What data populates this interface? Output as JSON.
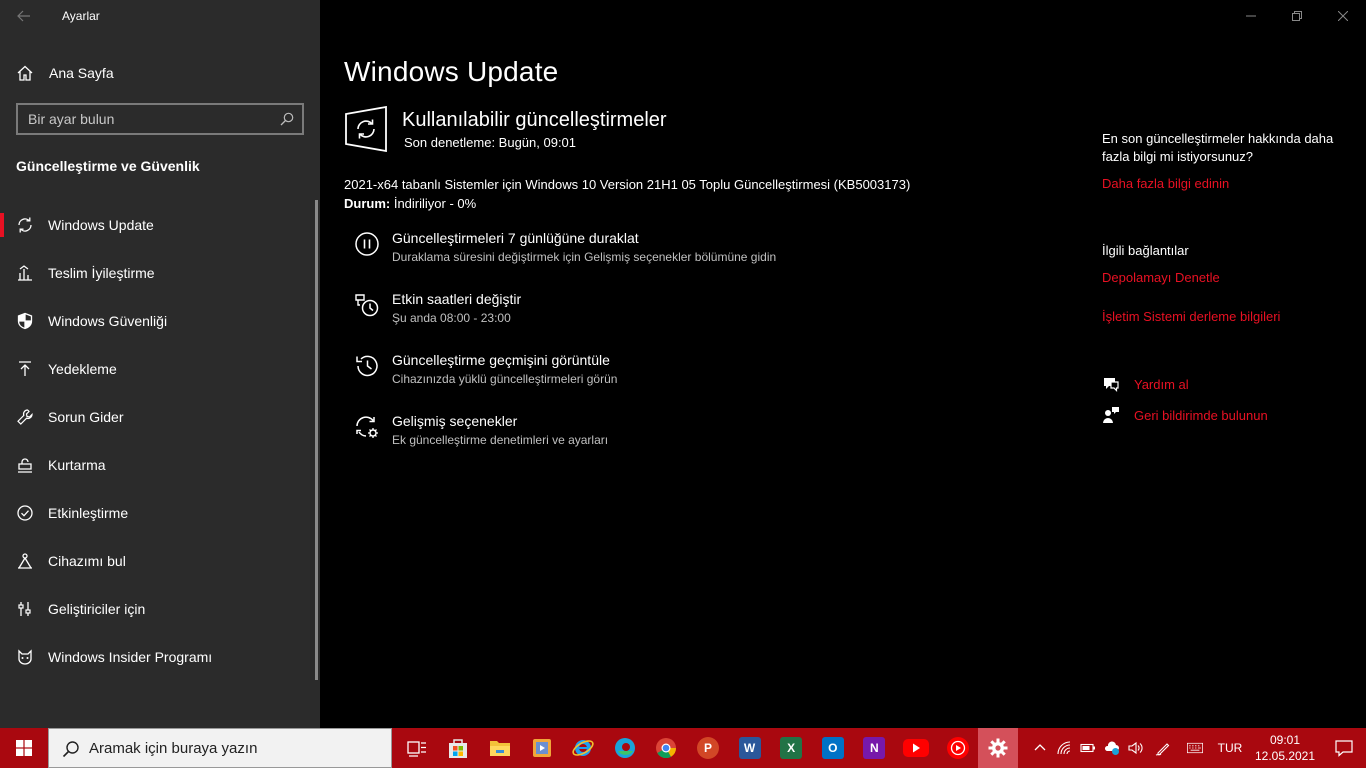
{
  "window": {
    "title": "Ayarlar"
  },
  "sidebar": {
    "home_label": "Ana Sayfa",
    "search_placeholder": "Bir ayar bulun",
    "section_title": "Güncelleştirme ve Güvenlik",
    "items": [
      {
        "label": "Windows Update",
        "icon": "sync-icon",
        "active": true
      },
      {
        "label": "Teslim İyileştirme",
        "icon": "delivery-optimization-icon"
      },
      {
        "label": "Windows Güvenliği",
        "icon": "shield-icon"
      },
      {
        "label": "Yedekleme",
        "icon": "backup-arrow-icon"
      },
      {
        "label": "Sorun Gider",
        "icon": "wrench-icon"
      },
      {
        "label": "Kurtarma",
        "icon": "recovery-icon"
      },
      {
        "label": "Etkinleştirme",
        "icon": "check-circle-icon"
      },
      {
        "label": "Cihazımı bul",
        "icon": "find-device-icon"
      },
      {
        "label": "Geliştiriciler için",
        "icon": "developer-sliders-icon"
      },
      {
        "label": "Windows Insider Programı",
        "icon": "insider-cat-icon"
      }
    ]
  },
  "main": {
    "title": "Windows Update",
    "status_heading": "Kullanılabilir güncelleştirmeler",
    "last_checked": "Son denetleme: Bugün, 09:01",
    "update_name": "2021-x64 tabanlı Sistemler için Windows 10 Version 21H1 05 Toplu Güncelleştirmesi (KB5003173)",
    "status_label": "Durum:",
    "status_value": " İndiriliyor - 0%",
    "options": [
      {
        "title": "Güncelleştirmeleri 7 günlüğüne duraklat",
        "desc": "Duraklama süresini değiştirmek için Gelişmiş seçenekler bölümüne gidin",
        "icon": "pause-icon"
      },
      {
        "title": "Etkin saatleri değiştir",
        "desc": "Şu anda 08:00 - 23:00",
        "icon": "active-hours-clock-icon"
      },
      {
        "title": "Güncelleştirme geçmişini görüntüle",
        "desc": "Cihazınızda yüklü güncelleştirmeleri görün",
        "icon": "history-icon"
      },
      {
        "title": "Gelişmiş seçenekler",
        "desc": "Ek güncelleştirme denetimleri ve ayarları",
        "icon": "advanced-sync-gear-icon"
      }
    ]
  },
  "rail": {
    "info_text": "En son güncelleştirmeler hakkında daha fazla bilgi mi istiyorsunuz?",
    "info_link": "Daha fazla bilgi edinin",
    "related_title": "İlgili bağlantılar",
    "related_links": [
      "Depolamayı Denetle",
      "İşletim Sistemi derleme bilgileri"
    ],
    "help_label": "Yardım al",
    "feedback_label": "Geri bildirimde bulunun"
  },
  "taskbar": {
    "search_placeholder": "Aramak için buraya yazın",
    "apps": [
      {
        "name": "task-view",
        "color": "#ffffff",
        "glyph": ""
      },
      {
        "name": "microsoft-store",
        "color": "#ffffff",
        "glyph": ""
      },
      {
        "name": "file-explorer",
        "color": "#f3c13a",
        "glyph": ""
      },
      {
        "name": "media-player",
        "color": "#f3a33a",
        "glyph": "▶"
      },
      {
        "name": "internet-explorer",
        "color": "#1e90ff",
        "glyph": "e"
      },
      {
        "name": "edge",
        "color": "#0f9bd7",
        "glyph": ""
      },
      {
        "name": "chrome",
        "color": "#ffffff",
        "glyph": ""
      },
      {
        "name": "powerpoint",
        "color": "#d24726",
        "glyph": "P"
      },
      {
        "name": "word",
        "color": "#2b579a",
        "glyph": "W"
      },
      {
        "name": "excel",
        "color": "#217346",
        "glyph": "X"
      },
      {
        "name": "outlook",
        "color": "#0072c6",
        "glyph": "O"
      },
      {
        "name": "onenote",
        "color": "#7719aa",
        "glyph": "N"
      },
      {
        "name": "youtube",
        "color": "#ff0000",
        "glyph": "▶"
      },
      {
        "name": "youtube-music",
        "color": "#ff0000",
        "glyph": "▶"
      },
      {
        "name": "settings",
        "color": "#ffffff",
        "glyph": ""
      }
    ],
    "language": "TUR",
    "time": "09:01",
    "date": "12.05.2021"
  },
  "colors": {
    "accent": "#e81123",
    "taskbar": "#a9080f",
    "sidebar": "#2b2b2b"
  }
}
